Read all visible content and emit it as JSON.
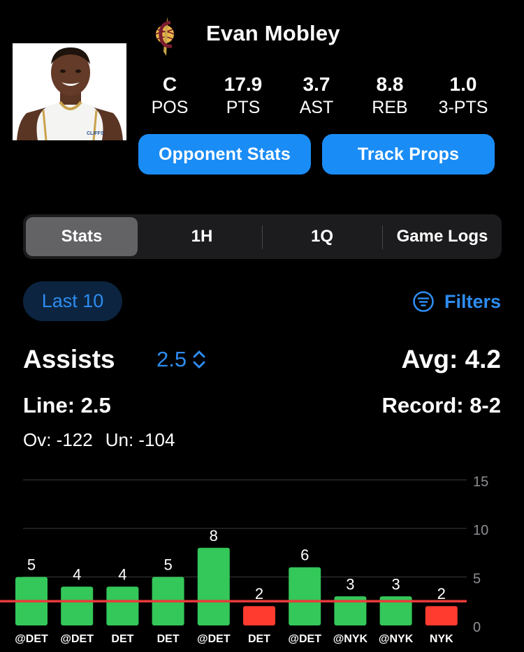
{
  "player": {
    "name": "Evan Mobley"
  },
  "stats": [
    {
      "value": "C",
      "label": "POS"
    },
    {
      "value": "17.9",
      "label": "PTS"
    },
    {
      "value": "3.7",
      "label": "AST"
    },
    {
      "value": "8.8",
      "label": "REB"
    },
    {
      "value": "1.0",
      "label": "3-PTS"
    }
  ],
  "buttons": {
    "opponent": "Opponent Stats",
    "track": "Track Props"
  },
  "tabs": [
    "Stats",
    "1H",
    "1Q",
    "Game Logs"
  ],
  "active_tab": "Stats",
  "filter": {
    "range": "Last 10",
    "filters_label": "Filters"
  },
  "prop": {
    "metric": "Assists",
    "line_value": "2.5",
    "avg": "Avg: 4.2",
    "line_text": "Line: 2.5",
    "record": "Record: 8-2",
    "over": "Ov: -122",
    "under": "Un: -104"
  },
  "colors": {
    "accent": "#1a8cf5",
    "over": "#34c759",
    "under": "#ff3b30",
    "line": "#e83a3a"
  },
  "chart_data": {
    "type": "bar",
    "categories": [
      "@DET",
      "@DET",
      "DET",
      "DET",
      "@DET",
      "DET",
      "@DET",
      "@NYK",
      "@NYK",
      "NYK"
    ],
    "values": [
      5,
      4,
      4,
      5,
      8,
      2,
      6,
      3,
      3,
      2
    ],
    "yticks": [
      "0",
      "5",
      "10",
      "15"
    ],
    "ylim": [
      0,
      15
    ],
    "threshold": 2.5,
    "grid": true
  }
}
